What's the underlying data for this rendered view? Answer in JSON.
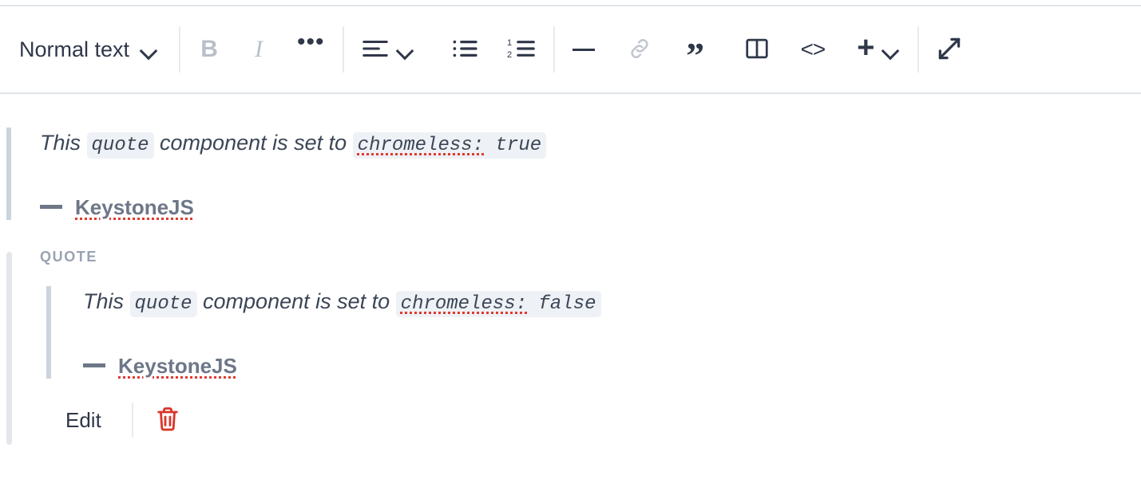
{
  "toolbar": {
    "style_select": {
      "label": "Normal text",
      "icon": "chevron-down-icon"
    },
    "bold": {
      "label": "B",
      "name": "bold-button",
      "state": "disabled"
    },
    "italic": {
      "label": "I",
      "name": "italic-button",
      "state": "disabled"
    },
    "more": {
      "label": "•••",
      "name": "more-formatting-button"
    },
    "align": {
      "label": "align-left-icon",
      "name": "text-align-button"
    },
    "bulleted_list": {
      "label": "bulleted-list-icon",
      "name": "bulleted-list-button"
    },
    "numbered_list": {
      "label": "numbered-list-icon",
      "name": "numbered-list-button"
    },
    "divider": {
      "label": "divider-icon",
      "name": "insert-divider-button"
    },
    "link": {
      "label": "link-icon",
      "name": "insert-link-button",
      "state": "disabled"
    },
    "blockquote": {
      "label": "”",
      "name": "blockquote-button"
    },
    "layout": {
      "label": "layout-columns-icon",
      "name": "insert-layout-button"
    },
    "code": {
      "label": "<>",
      "name": "code-block-button"
    },
    "insert": {
      "label": "+",
      "name": "insert-component-button"
    },
    "expand": {
      "label": "expand-icon",
      "name": "fullscreen-button"
    }
  },
  "editor": {
    "quote_plain": {
      "text_before": "This ",
      "code_1": "quote",
      "text_middle": " component is set to ",
      "code_2_spell": "chromeless:",
      "code_2_rest": " true",
      "attribution": "KeystoneJS"
    },
    "quote_chrome": {
      "block_label": "QUOTE",
      "text_before": "This ",
      "code_1": "quote",
      "text_middle": " component is set to ",
      "code_2_spell": "chromeless:",
      "code_2_rest": " false",
      "attribution": "KeystoneJS",
      "edit_label": "Edit",
      "delete_label": "delete-icon"
    }
  },
  "colors": {
    "text": "#2f3749",
    "muted": "#6d7787",
    "quote_bar": "#ccd4dd",
    "chrome_bar": "#e3e6eb",
    "code_bg": "#eef1f5",
    "spell_red": "#e03a2f",
    "danger": "#d9372a",
    "rule": "#e1e5ea",
    "disabled": "#b9bfc9"
  }
}
